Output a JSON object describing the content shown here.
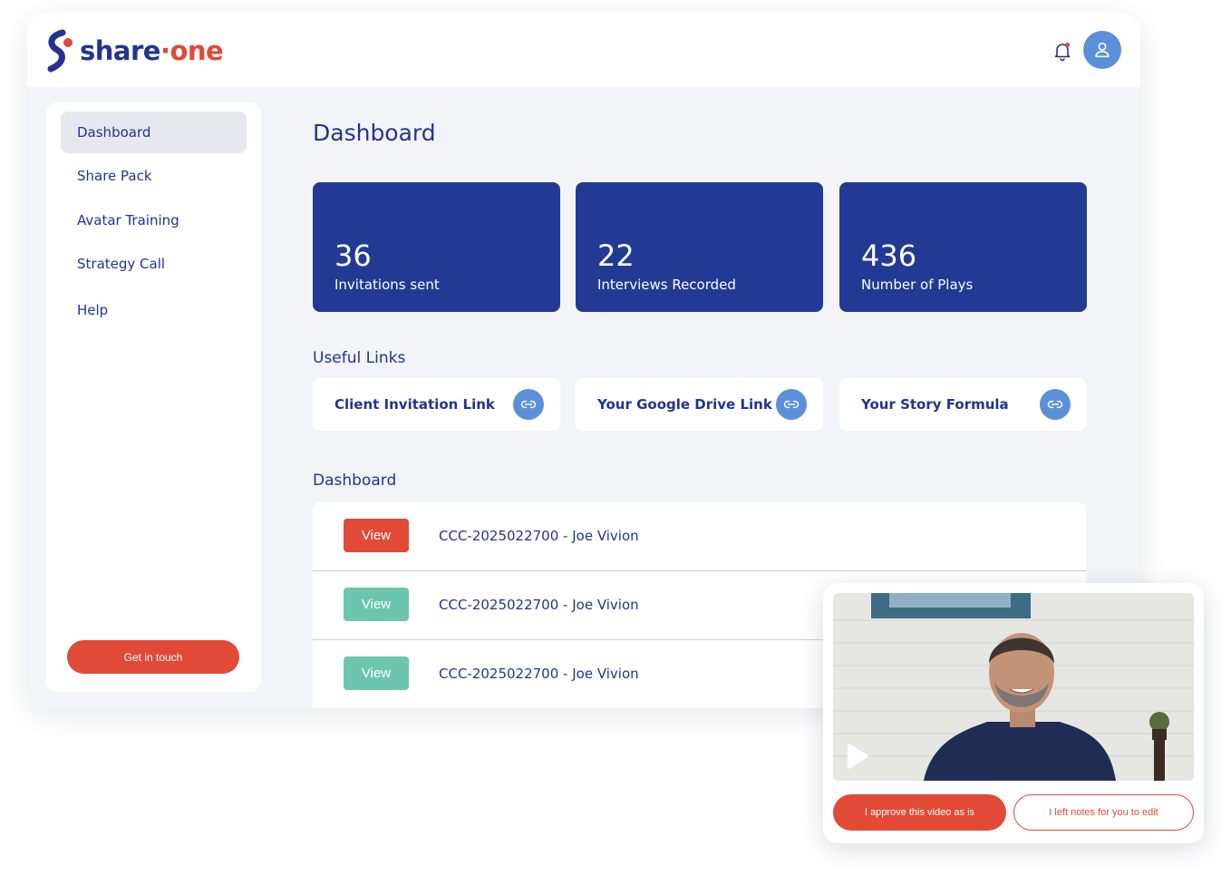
{
  "brand": {
    "part1": "share",
    "dot": "·",
    "part2": "one"
  },
  "header": {
    "bell_icon": "bell-icon",
    "avatar_icon": "user-icon"
  },
  "sidebar": {
    "items": [
      {
        "label": "Dashboard",
        "active": true
      },
      {
        "label": "Share Pack",
        "active": false
      },
      {
        "label": "Avatar Training",
        "active": false
      },
      {
        "label": "Strategy Call",
        "active": false
      },
      {
        "label": "Help",
        "active": false
      }
    ],
    "cta_label": "Get in touch"
  },
  "main": {
    "title": "Dashboard",
    "stats": [
      {
        "value": "36",
        "label": "Invitations sent"
      },
      {
        "value": "22",
        "label": "Interviews Recorded"
      },
      {
        "value": "436",
        "label": "Number of Plays"
      }
    ],
    "links_heading": "Useful Links",
    "links": [
      {
        "label": "Client Invitation Link",
        "icon": "link-icon"
      },
      {
        "label": "Your Google Drive Link",
        "icon": "link-icon"
      },
      {
        "label": "Your Story Formula",
        "icon": "link-icon"
      }
    ],
    "table_heading": "Dashboard",
    "rows": [
      {
        "button": "View",
        "text": "CCC-2025022700 - Joe Vivion",
        "button_color": "#e04a36"
      },
      {
        "button": "View",
        "text": "CCC-2025022700 - Joe Vivion",
        "button_color": "#6cc6ad"
      },
      {
        "button": "View",
        "text": "CCC-2025022700 - Joe Vivion",
        "button_color": "#6cc6ad"
      }
    ]
  },
  "video_card": {
    "play_icon": "play-icon",
    "approve_label": "I approve this video as is",
    "notes_label": "I left notes for you to edit"
  },
  "colors": {
    "primary": "#233a94",
    "accent": "#e04a36",
    "teal": "#6cc6ad",
    "icon_blue": "#5b8fd9"
  }
}
